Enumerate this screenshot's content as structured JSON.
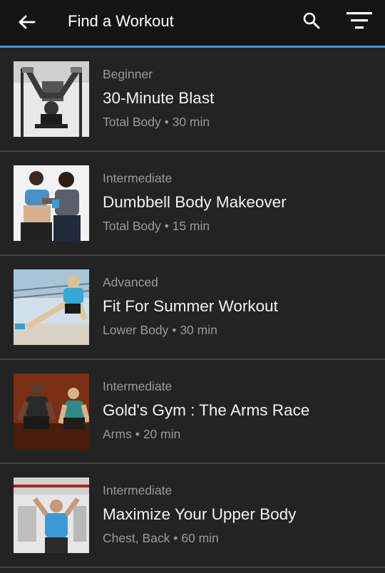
{
  "header": {
    "title": "Find a Workout",
    "back_icon": "arrow-left-icon",
    "search_icon": "search-icon",
    "filter_icon": "filter-icon",
    "accent_color": "#3a9bd8"
  },
  "workouts": [
    {
      "level": "Beginner",
      "name": "30-Minute Blast",
      "focus": "Total Body",
      "separator": "•",
      "duration": "30 min"
    },
    {
      "level": "Intermediate",
      "name": "Dumbbell Body Makeover",
      "focus": "Total Body",
      "separator": "•",
      "duration": "15 min"
    },
    {
      "level": "Advanced",
      "name": "Fit For Summer Workout",
      "focus": "Lower Body",
      "separator": "•",
      "duration": "30 min"
    },
    {
      "level": "Intermediate",
      "name": "Gold's Gym : The Arms Race",
      "focus": "Arms",
      "separator": "•",
      "duration": "20 min"
    },
    {
      "level": "Intermediate",
      "name": "Maximize Your Upper Body",
      "focus": "Chest, Back",
      "separator": "•",
      "duration": "60 min"
    }
  ]
}
